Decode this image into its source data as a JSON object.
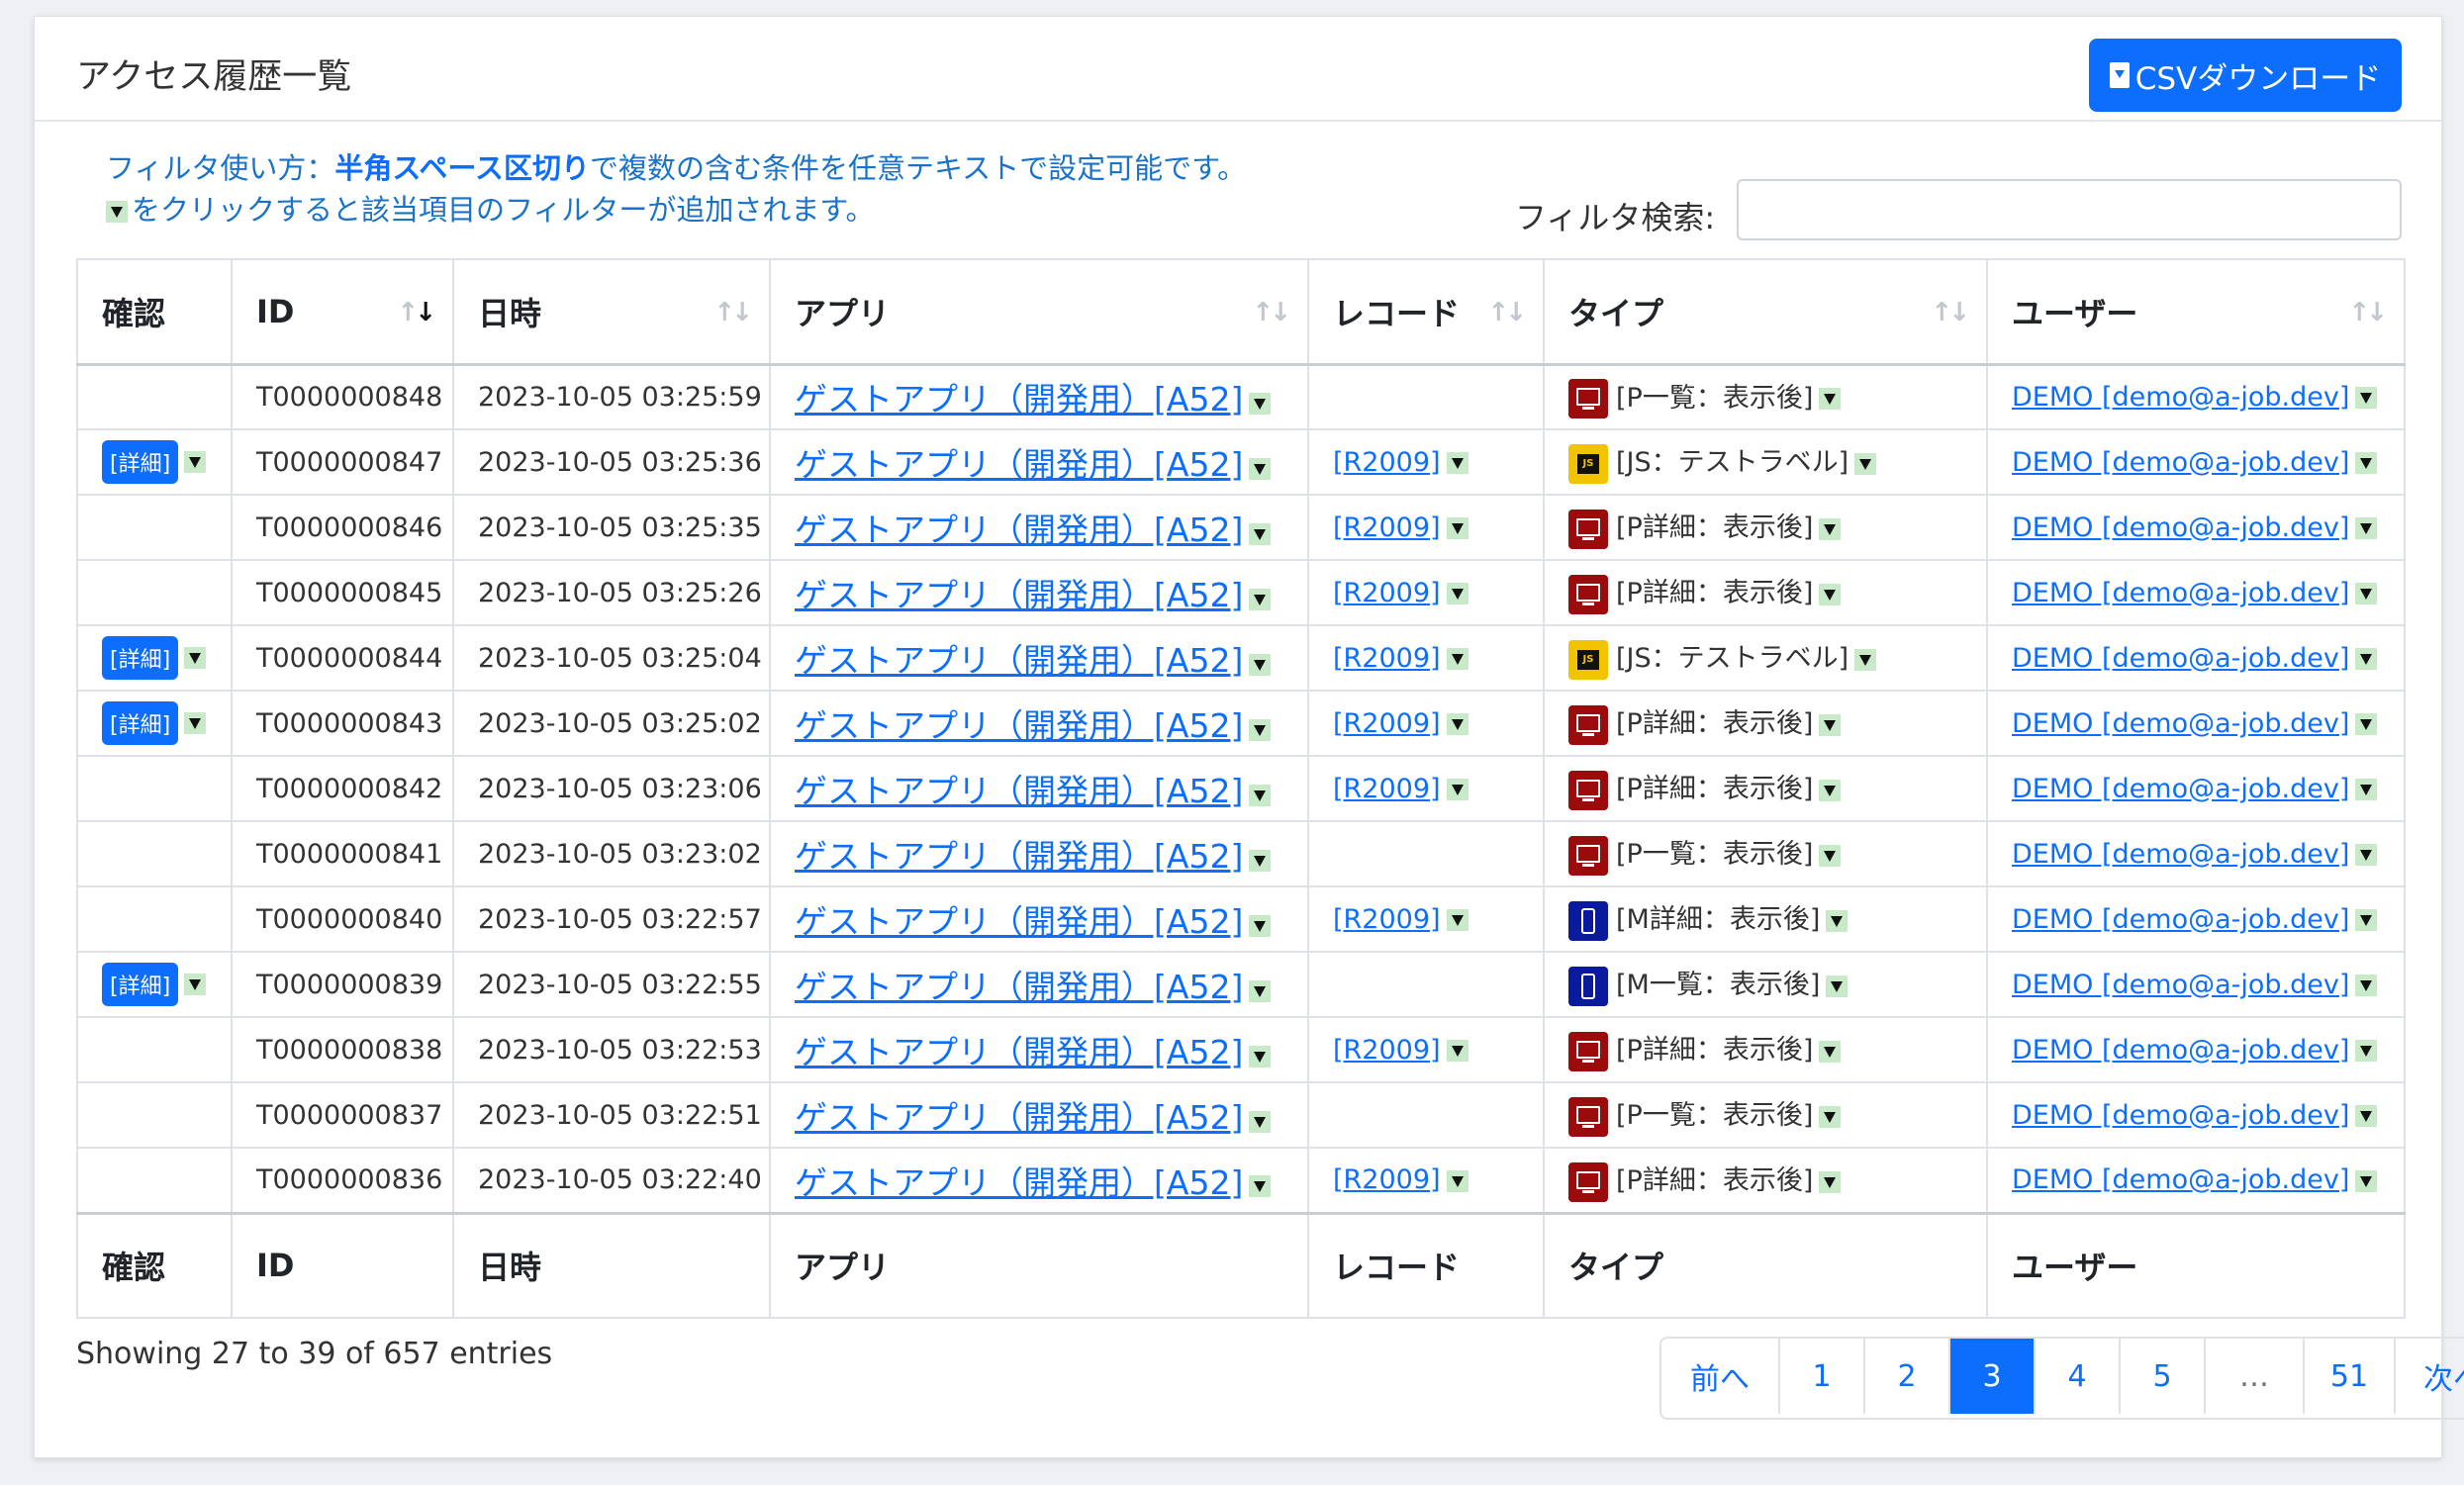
{
  "header": {
    "title": "アクセス履歴一覧",
    "csv_button": "CSVダウンロード"
  },
  "help": {
    "line1_prefix": "フィルタ使い方：",
    "line1_bold": "半角スペース区切り",
    "line1_suffix": "で複数の含む条件を任意テキストで設定可能です。",
    "line2": "をクリックすると該当項目のフィルターが追加されます。"
  },
  "filter": {
    "label": "フィルタ検索:",
    "value": ""
  },
  "table": {
    "columns": [
      "確認",
      "ID",
      "日時",
      "アプリ",
      "レコード",
      "タイプ",
      "ユーザー"
    ],
    "rows": [
      {
        "detail": "",
        "id": "T0000000848",
        "datetime": "2023-10-05 03:25:59",
        "app": "ゲストアプリ（開発用）[A52]",
        "record": "",
        "type_icon": "pc-icon",
        "type": "[P一覧：表示後]",
        "user": "DEMO [demo@a-job.dev]"
      },
      {
        "detail": "[詳細]",
        "id": "T0000000847",
        "datetime": "2023-10-05 03:25:36",
        "app": "ゲストアプリ（開発用）[A52]",
        "record": "[R2009]",
        "type_icon": "js-icon",
        "type": "[JS：テストラベル]",
        "user": "DEMO [demo@a-job.dev]"
      },
      {
        "detail": "",
        "id": "T0000000846",
        "datetime": "2023-10-05 03:25:35",
        "app": "ゲストアプリ（開発用）[A52]",
        "record": "[R2009]",
        "type_icon": "pc-icon",
        "type": "[P詳細：表示後]",
        "user": "DEMO [demo@a-job.dev]"
      },
      {
        "detail": "",
        "id": "T0000000845",
        "datetime": "2023-10-05 03:25:26",
        "app": "ゲストアプリ（開発用）[A52]",
        "record": "[R2009]",
        "type_icon": "pc-icon",
        "type": "[P詳細：表示後]",
        "user": "DEMO [demo@a-job.dev]"
      },
      {
        "detail": "[詳細]",
        "id": "T0000000844",
        "datetime": "2023-10-05 03:25:04",
        "app": "ゲストアプリ（開発用）[A52]",
        "record": "[R2009]",
        "type_icon": "js-icon",
        "type": "[JS：テストラベル]",
        "user": "DEMO [demo@a-job.dev]"
      },
      {
        "detail": "[詳細]",
        "id": "T0000000843",
        "datetime": "2023-10-05 03:25:02",
        "app": "ゲストアプリ（開発用）[A52]",
        "record": "[R2009]",
        "type_icon": "pc-icon",
        "type": "[P詳細：表示後]",
        "user": "DEMO [demo@a-job.dev]"
      },
      {
        "detail": "",
        "id": "T0000000842",
        "datetime": "2023-10-05 03:23:06",
        "app": "ゲストアプリ（開発用）[A52]",
        "record": "[R2009]",
        "type_icon": "pc-icon",
        "type": "[P詳細：表示後]",
        "user": "DEMO [demo@a-job.dev]"
      },
      {
        "detail": "",
        "id": "T0000000841",
        "datetime": "2023-10-05 03:23:02",
        "app": "ゲストアプリ（開発用）[A52]",
        "record": "",
        "type_icon": "pc-icon",
        "type": "[P一覧：表示後]",
        "user": "DEMO [demo@a-job.dev]"
      },
      {
        "detail": "",
        "id": "T0000000840",
        "datetime": "2023-10-05 03:22:57",
        "app": "ゲストアプリ（開発用）[A52]",
        "record": "[R2009]",
        "type_icon": "mobile-icon",
        "type": "[M詳細：表示後]",
        "user": "DEMO [demo@a-job.dev]"
      },
      {
        "detail": "[詳細]",
        "id": "T0000000839",
        "datetime": "2023-10-05 03:22:55",
        "app": "ゲストアプリ（開発用）[A52]",
        "record": "",
        "type_icon": "mobile-icon",
        "type": "[M一覧：表示後]",
        "user": "DEMO [demo@a-job.dev]"
      },
      {
        "detail": "",
        "id": "T0000000838",
        "datetime": "2023-10-05 03:22:53",
        "app": "ゲストアプリ（開発用）[A52]",
        "record": "[R2009]",
        "type_icon": "pc-icon",
        "type": "[P詳細：表示後]",
        "user": "DEMO [demo@a-job.dev]"
      },
      {
        "detail": "",
        "id": "T0000000837",
        "datetime": "2023-10-05 03:22:51",
        "app": "ゲストアプリ（開発用）[A52]",
        "record": "",
        "type_icon": "pc-icon",
        "type": "[P一覧：表示後]",
        "user": "DEMO [demo@a-job.dev]"
      },
      {
        "detail": "",
        "id": "T0000000836",
        "datetime": "2023-10-05 03:22:40",
        "app": "ゲストアプリ（開発用）[A52]",
        "record": "[R2009]",
        "type_icon": "pc-icon",
        "type": "[P詳細：表示後]",
        "user": "DEMO [demo@a-job.dev]"
      }
    ]
  },
  "info": "Showing 27 to 39 of 657 entries",
  "pagination": {
    "items": [
      "前へ",
      "1",
      "2",
      "3",
      "4",
      "5",
      "…",
      "51",
      "次へ"
    ],
    "active": "3"
  },
  "colors": {
    "accent": "#0d6efd",
    "pc_icon": "#9b0b0b",
    "mobile_icon": "#0a1a9c",
    "js_icon": "#f2c400",
    "filter_btn": "#c8eac8"
  }
}
